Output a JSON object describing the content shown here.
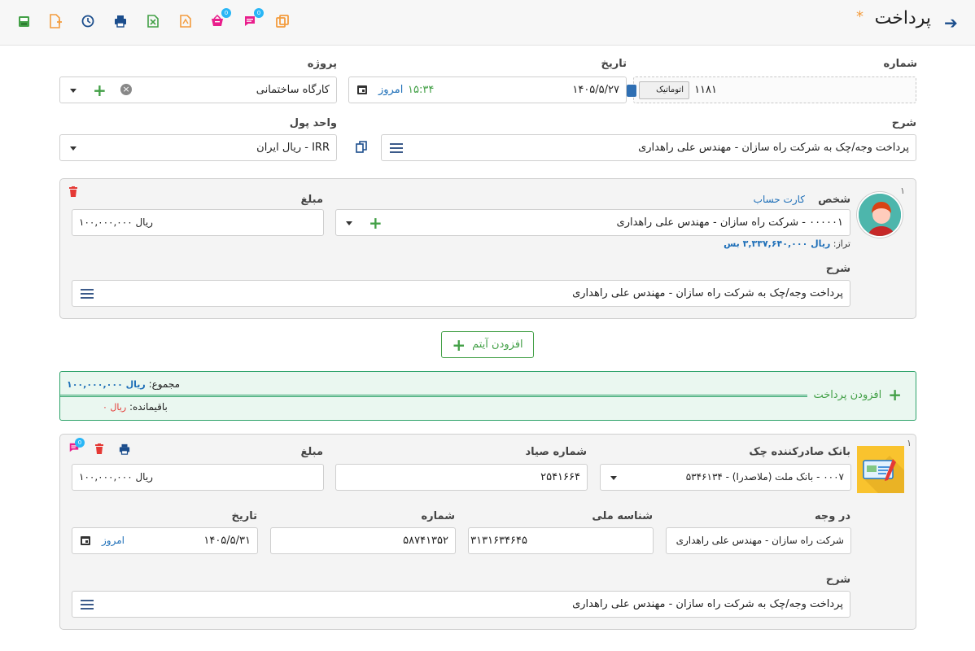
{
  "header": {
    "title": "پرداخت",
    "modified_mark": "*",
    "back_icon": "arrow-right-icon",
    "toolbar": [
      {
        "name": "copy-icon",
        "color": "#f39c3e",
        "badge": ""
      },
      {
        "name": "chat-icon",
        "color": "#e91e8c",
        "badge": "0"
      },
      {
        "name": "basket-icon",
        "color": "#e91e8c",
        "badge": "0"
      },
      {
        "name": "pdf-icon",
        "color": "#f39c3e",
        "badge": ""
      },
      {
        "name": "excel-icon",
        "color": "#43a047",
        "badge": ""
      },
      {
        "name": "print-icon",
        "color": "#1b4d8c",
        "badge": ""
      },
      {
        "name": "history-icon",
        "color": "#1b4d8c",
        "badge": ""
      },
      {
        "name": "new-doc-icon",
        "color": "#f39c3e",
        "badge": ""
      },
      {
        "name": "save-icon",
        "color": "#43a047",
        "badge": ""
      }
    ]
  },
  "form": {
    "number_label": "شماره",
    "number_value": "۱۱۸۱",
    "auto_label": "اتوماتیک",
    "date_label": "تاریخ",
    "date_value": "۱۴۰۵/۵/۲۷",
    "time_value": "۱۵:۳۴",
    "today_label": "امروز",
    "project_label": "پروژه",
    "project_value": "کارگاه ساختمانی",
    "desc_label": "شرح",
    "desc_value": "پرداخت وجه/چک به شرکت راه سازان - مهندس علی راهداری",
    "currency_label": "واحد پول",
    "currency_value": "IRR - ریال ایران"
  },
  "item": {
    "index": "۱",
    "person_label": "شخص",
    "account_card_link": "کارت حساب",
    "person_value": "۰۰۰۰۰۱ - شرکت راه سازان - مهندس علی راهداری",
    "balance_label": "تراز:",
    "balance_value": "ریال ۳,۳۳۷,۶۴۰,۰۰۰ بس",
    "amount_label": "مبلغ",
    "amount_value": "ریال ۱۰۰,۰۰۰,۰۰۰",
    "desc_label": "شرح",
    "desc_value": "پرداخت وجه/چک به شرکت راه سازان - مهندس علی راهداری"
  },
  "add_item_label": "افزودن آیتم",
  "summary": {
    "add_payment_label": "افزودن پرداخت",
    "total_label": "مجموع:",
    "total_value": "ریال ۱۰۰,۰۰۰,۰۰۰",
    "remaining_label": "باقیمانده:",
    "remaining_value": "ریال ۰"
  },
  "cheque": {
    "index": "۱",
    "badge": "0",
    "bank_label": "بانک صادرکننده چک",
    "bank_value": "۰۰۰۷ - بانک ملت (ملاصدرا) - ۵۳۴۶۱۳۴",
    "sayad_label": "شماره صیاد",
    "sayad_value": "۲۵۴۱۶۶۴",
    "amount_label": "مبلغ",
    "amount_value": "ریال ۱۰۰,۰۰۰,۰۰۰",
    "payee_label": "در وجه",
    "payee_value": "شرکت راه سازان - مهندس علی راهداری",
    "national_id_label": "شناسه ملی",
    "national_id_value": "۳۱۳۱۶۳۴۶۴۵",
    "number_label": "شماره",
    "number_value": "۵۸۷۴۱۳۵۲",
    "date_label": "تاریخ",
    "date_value": "۱۴۰۵/۵/۳۱",
    "today_label": "امروز",
    "desc_label": "شرح",
    "desc_value": "پرداخت وجه/چک به شرکت راه سازان - مهندس علی راهداری"
  }
}
